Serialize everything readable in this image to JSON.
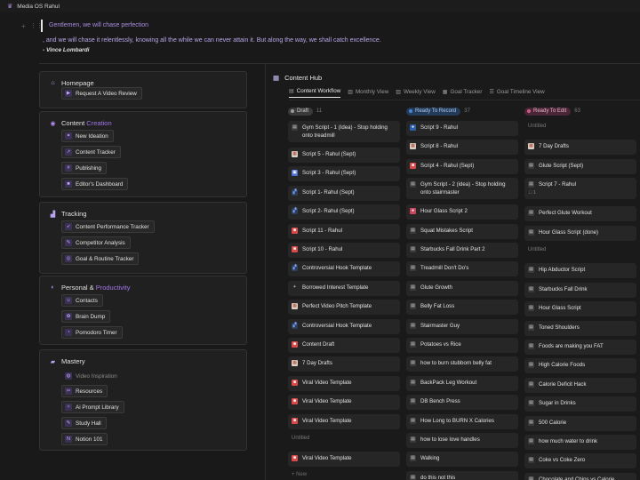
{
  "app": {
    "title": "Media OS Rahul"
  },
  "quote": {
    "line1": "Gentlemen, we will chase perfection",
    "line2": ", and we will chase it relentlessly, knowing all the while we can never attain it. But along the way, we shall catch excellence.",
    "line3": "- Vince Lombardi"
  },
  "sidebar": {
    "homepage": {
      "title": "Homepage",
      "items": [
        {
          "label": "Request A Video Review",
          "icon": "video-icon"
        }
      ]
    },
    "content": {
      "title": "Content",
      "title_accent": "Creation",
      "items": [
        {
          "label": "New Ideation",
          "icon": "sparkle-icon"
        },
        {
          "label": "Content Tracker",
          "icon": "arrow-icon"
        },
        {
          "label": "Publishing",
          "icon": "hash-icon"
        },
        {
          "label": "Editor's Dashboard",
          "icon": "camera-icon"
        }
      ]
    },
    "tracking": {
      "title": "Tracking",
      "items": [
        {
          "label": "Content Performance Tracker",
          "icon": "rocket-icon"
        },
        {
          "label": "Competitor Analysis",
          "icon": "pen-icon"
        },
        {
          "label": "Goal & Routine Tracker",
          "icon": "target-icon"
        }
      ]
    },
    "personal": {
      "title": "Personal &",
      "title_accent": "Productivity",
      "items": [
        {
          "label": "Contacts",
          "icon": "contacts-icon"
        },
        {
          "label": "Brain Dump",
          "icon": "brain-icon"
        },
        {
          "label": "Pomodoro Timer",
          "icon": "timer-icon"
        }
      ]
    },
    "mastery": {
      "title": "Mastery",
      "items": [
        {
          "label": "Video Inspiration",
          "icon": "film-icon"
        },
        {
          "label": "Resources",
          "icon": "tools-icon"
        },
        {
          "label": "Ai Prompt Library",
          "icon": "ai-icon"
        },
        {
          "label": "Study Hall",
          "icon": "pencil-icon"
        },
        {
          "label": "Notion 101",
          "icon": "notion-icon"
        }
      ]
    }
  },
  "hub": {
    "title": "Content Hub",
    "tabs": [
      "Content Workflow",
      "Monthly View",
      "Weekly View",
      "Goal Tracker",
      "Goal Timeline View"
    ],
    "columns": [
      {
        "status": "Draft",
        "count": "11",
        "status_bg": "#3a3a3a",
        "status_fg": "#d0d0d0",
        "dot": "#9b9b9b"
      },
      {
        "status": "Ready To Record",
        "count": "37",
        "status_bg": "#233a59",
        "status_fg": "#a9c8ef",
        "dot": "#4b86d3"
      },
      {
        "status": "Ready To Edit",
        "count": "63",
        "status_bg": "#4a2637",
        "status_fg": "#eab1c9",
        "dot": "#d05a8c"
      }
    ],
    "col1_items": [
      {
        "label": "Gym Script - 1 (Idea) - Stop holding onto treadmill",
        "icon": "doc-icon"
      },
      {
        "label": "Script 5 - Rahul (Sept)",
        "icon": "calendar-icon"
      },
      {
        "label": "Script 3 - Rahul (Sept)",
        "icon": "frame-icon"
      },
      {
        "label": "Script 1- Rahul (Sept)",
        "icon": "chart-icon"
      },
      {
        "label": "Script 2- Rahul (Sept)",
        "icon": "chart-icon"
      },
      {
        "label": "Script 11 - Rahul",
        "icon": "red-square-icon"
      },
      {
        "label": "Script 10 - Rahul",
        "icon": "red-square-icon"
      },
      {
        "label": "Controversial Hook Template",
        "icon": "chart-icon"
      },
      {
        "label": "Borrowed Interest Template",
        "icon": "plus-icon"
      },
      {
        "label": "Perfect Video Pitch Template",
        "icon": "calendar-icon"
      },
      {
        "label": "Controversial Hook Template",
        "icon": "chart-icon"
      },
      {
        "label": "Content Draft",
        "icon": "red-square-icon"
      },
      {
        "label": "7 Day Drafts",
        "icon": "calendar-icon"
      },
      {
        "label": "Viral Video Template",
        "icon": "red-square-icon"
      },
      {
        "label": "Viral Video Template",
        "icon": "red-square-icon"
      },
      {
        "label": "Viral Video Template",
        "icon": "red-square-icon"
      },
      {
        "label": "Viral Video Template",
        "icon": "red-square-icon"
      }
    ],
    "col1_untitled": "Untitled",
    "col1_new": "+ New",
    "col2_items": [
      {
        "label": "Script 9 - Rahul",
        "icon": "chat-icon"
      },
      {
        "label": "Script 8 - Rahul",
        "icon": "calendar-icon"
      },
      {
        "label": "Script 4 - Rahul (Sept)",
        "icon": "red-square-icon"
      },
      {
        "label": "Gym Script - 2 (idea) - Stop holding onto stairmaster",
        "icon": "doc-icon"
      },
      {
        "label": "Hour Glass Script 2",
        "icon": "lips-icon"
      },
      {
        "label": "Squat Mistakes Script",
        "icon": "doc-icon"
      },
      {
        "label": "Starbucks Fall Drink Part 2",
        "icon": "doc-icon"
      },
      {
        "label": "Treadmill Don't Do's",
        "icon": "doc-icon"
      },
      {
        "label": "Glute Growth",
        "icon": "doc-icon"
      },
      {
        "label": "Belly Fat Loss",
        "icon": "doc-icon"
      },
      {
        "label": "Stairmaster Guy",
        "icon": "doc-icon"
      },
      {
        "label": "Potatoes vs Rice",
        "icon": "doc-icon"
      },
      {
        "label": "how to burn stubborn belly fat",
        "icon": "doc-icon"
      },
      {
        "label": "BackPack Leg Workout",
        "icon": "doc-icon"
      },
      {
        "label": "DB Bench Press",
        "icon": "doc-icon"
      },
      {
        "label": "How Long to BURN X Calories",
        "icon": "doc-icon"
      },
      {
        "label": "how to lose love handles",
        "icon": "doc-icon"
      },
      {
        "label": "Walking",
        "icon": "doc-icon"
      },
      {
        "label": "do this not this",
        "icon": "doc-icon"
      }
    ],
    "col3_untitled_top": "Untitled",
    "col3_items_a": [
      {
        "label": "7 Day Drafts",
        "icon": "calendar-icon"
      },
      {
        "label": "Glute Script (Sept)",
        "icon": "doc-icon"
      },
      {
        "label": "Script 7 - Rahul",
        "icon": "doc-icon",
        "sub": "□ 1"
      },
      {
        "label": "Perfect Glute Workout",
        "icon": "doc-icon"
      },
      {
        "label": "Hour Glass Script (done)",
        "icon": "doc-icon"
      }
    ],
    "col3_untitled_mid": "Untitled",
    "col3_items_b": [
      {
        "label": "Hip Abductor Script",
        "icon": "doc-icon"
      },
      {
        "label": "Starbucks Fall Drink",
        "icon": "doc-icon"
      },
      {
        "label": "Hour Glass Script",
        "icon": "doc-icon"
      },
      {
        "label": "Toned Shoulders",
        "icon": "doc-icon"
      },
      {
        "label": "Foods are making you FAT",
        "icon": "doc-icon"
      },
      {
        "label": "High Calorie Foods",
        "icon": "doc-icon"
      },
      {
        "label": "Calorie Deficit Hack",
        "icon": "doc-icon"
      },
      {
        "label": "Sugar in Drinks",
        "icon": "doc-icon"
      },
      {
        "label": "500 Calorie",
        "icon": "doc-icon"
      },
      {
        "label": "how much water to drink",
        "icon": "doc-icon"
      },
      {
        "label": "Coke vs Coke Zero",
        "icon": "doc-icon"
      },
      {
        "label": "Chocolate and Chips vs Calorie",
        "icon": "doc-icon"
      }
    ]
  }
}
